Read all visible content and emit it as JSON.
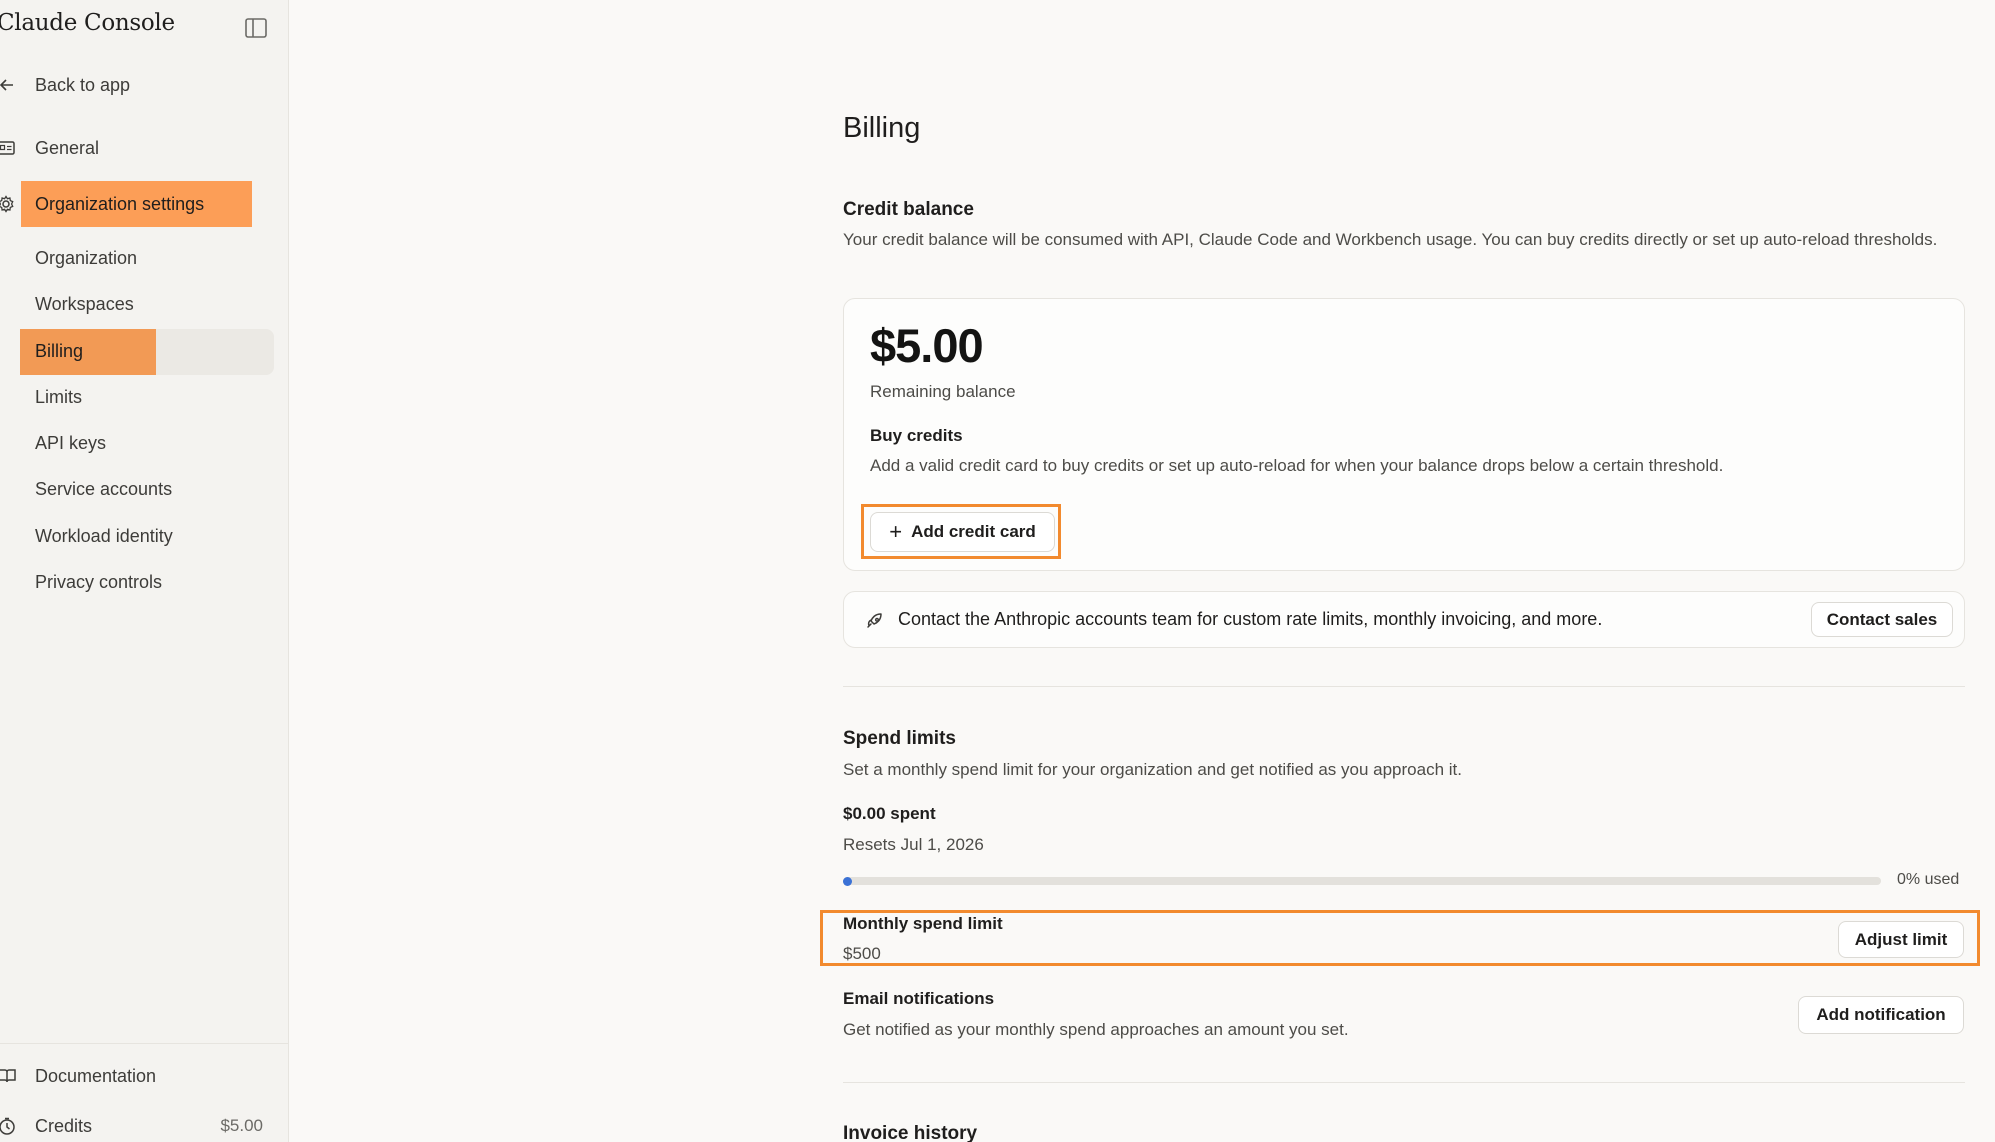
{
  "sidebar": {
    "brand": "Claude Console",
    "back_label": "Back to app",
    "general_label": "General",
    "org_settings_label": "Organization settings",
    "sub_items": [
      {
        "label": "Organization"
      },
      {
        "label": "Workspaces"
      },
      {
        "label": "Billing"
      },
      {
        "label": "Limits"
      },
      {
        "label": "API keys"
      },
      {
        "label": "Service accounts"
      },
      {
        "label": "Workload identity"
      },
      {
        "label": "Privacy controls"
      }
    ],
    "docs_label": "Documentation",
    "credits_label": "Credits",
    "credits_value": "$5.00"
  },
  "page": {
    "title": "Billing",
    "credit_balance": {
      "title": "Credit balance",
      "description": "Your credit balance will be consumed with API, Claude Code and Workbench usage. You can buy credits directly or set up auto-reload thresholds.",
      "amount": "$5.00",
      "amount_label": "Remaining balance",
      "buy_title": "Buy credits",
      "buy_desc": "Add a valid credit card to buy credits or set up auto-reload for when your balance drops below a certain threshold.",
      "add_card_label": "Add credit card"
    },
    "contact": {
      "text": "Contact the Anthropic accounts team for custom rate limits, monthly invoicing, and more.",
      "button_label": "Contact sales"
    },
    "spend_limits": {
      "title": "Spend limits",
      "description": "Set a monthly spend limit for your organization and get notified as you approach it.",
      "spent": "$0.00 spent",
      "resets": "Resets Jul 1, 2026",
      "used_fraction": 0,
      "used_label": "0% used",
      "monthly_title": "Monthly spend limit",
      "monthly_value": "$500",
      "adjust_label": "Adjust limit",
      "email_title": "Email notifications",
      "email_desc": "Get notified as your monthly spend approaches an amount you set.",
      "add_notification_label": "Add notification"
    },
    "invoice_title": "Invoice history"
  },
  "colors": {
    "accent_orange": "#fc9e57",
    "highlight_outline": "#f28a2e",
    "progress": "#3b72d6"
  }
}
